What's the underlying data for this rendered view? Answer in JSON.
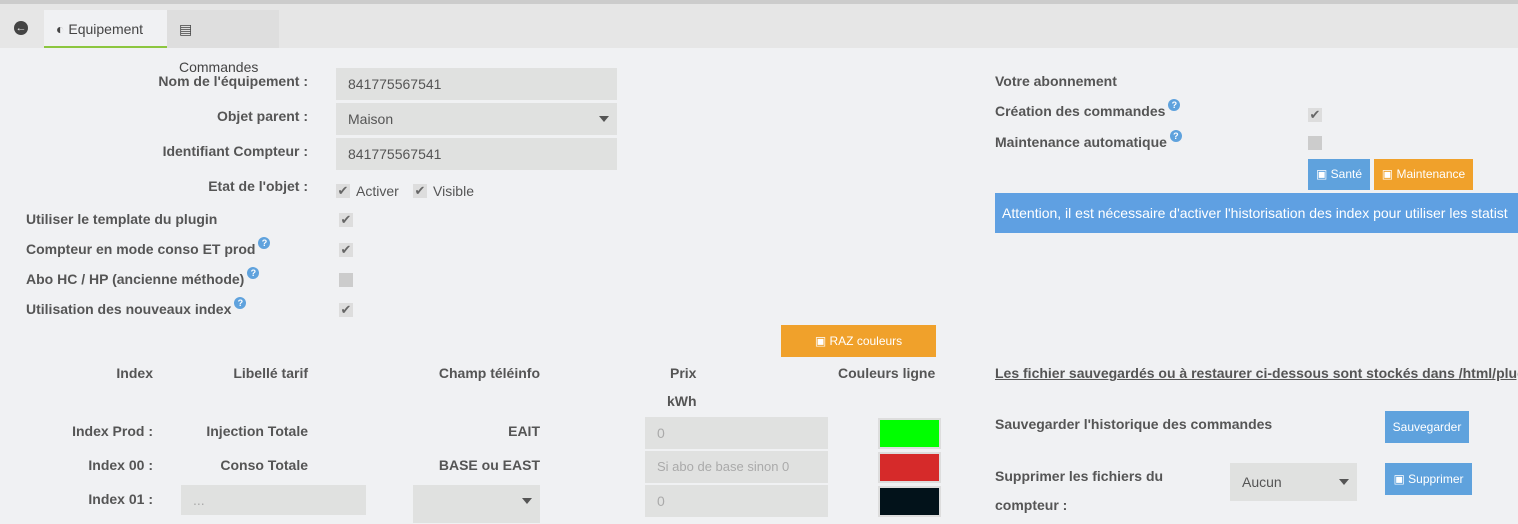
{
  "tabs": {
    "back": "back",
    "equipement": "Equipement",
    "commandes": "Commandes"
  },
  "form": {
    "nom_label": "Nom de l'équipement :",
    "nom_value": "841775567541",
    "parent_label": "Objet parent :",
    "parent_value": "Maison",
    "ident_label": "Identifiant Compteur :",
    "ident_value": "841775567541",
    "etat_label": "Etat de l'objet :",
    "activer": "Activer",
    "visible": "Visible",
    "template_label": "Utiliser le template du plugin",
    "conso_prod_label": "Compteur en mode conso ET prod",
    "abo_label": "Abo HC / HP (ancienne méthode)",
    "nouveaux_label": "Utilisation des nouveaux index"
  },
  "right": {
    "abonnement": "Votre abonnement",
    "creation": "Création des commandes",
    "maintenance_auto": "Maintenance automatique",
    "sante_btn": "Santé",
    "maintenance_btn": "Maintenance",
    "alert": "Attention, il est nécessaire d'activer l'historisation des index pour utiliser les statist",
    "storage_note": "Les fichier sauvegardés ou à restaurer ci-dessous sont stockés dans /html/plugins/",
    "save_label": "Sauvegarder l'historique des commandes",
    "save_btn": "Sauvegarder",
    "delete_label1": "Supprimer les fichiers du",
    "delete_label2": "compteur :",
    "delete_select": "Aucun",
    "delete_btn": "Supprimer"
  },
  "table": {
    "raz_btn": "RAZ couleurs",
    "headers": {
      "index": "Index",
      "libelle": "Libellé tarif",
      "champ": "Champ téléinfo",
      "prix": "Prix",
      "unit": "kWh",
      "couleurs": "Couleurs ligne"
    },
    "rows": [
      {
        "index": "Index Prod :",
        "libelle": "Injection Totale",
        "champ": "EAIT",
        "prix": "0",
        "color": "#00ff00"
      },
      {
        "index": "Index 00 :",
        "libelle": "Conso Totale",
        "champ": "BASE ou EAST",
        "prix": "Si abo de base sinon 0",
        "color": "#d62a2a"
      },
      {
        "index": "Index 01 :",
        "libelle": "...",
        "champ": "",
        "prix": "0",
        "color": "#02121a"
      }
    ]
  }
}
